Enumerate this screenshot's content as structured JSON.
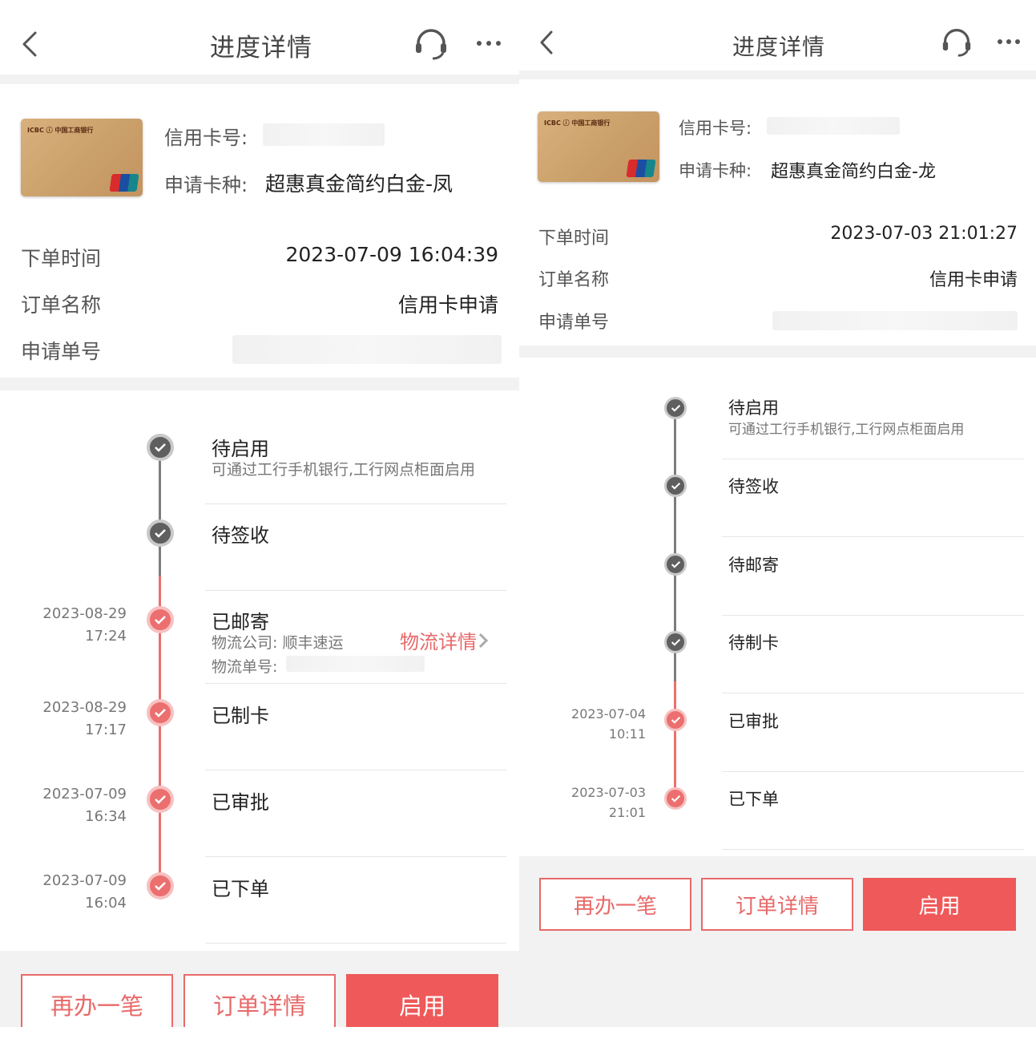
{
  "left": {
    "nav": {
      "title": "进度详情"
    },
    "card": {
      "number_label": "信用卡号:",
      "type_label": "申请卡种:",
      "type_value": "超惠真金简约白金-凤",
      "bank_text": "ICBC ⓘ 中国工商银行"
    },
    "order": [
      {
        "label": "下单时间",
        "value": "2023-07-09 16:04:39"
      },
      {
        "label": "订单名称",
        "value": "信用卡申请"
      },
      {
        "label": "申请单号",
        "value": ""
      }
    ],
    "timeline": [
      {
        "title": "待启用",
        "sub": "可通过工行手机银行,工行网点柜面启用",
        "date": "",
        "time": "",
        "state": "gray"
      },
      {
        "title": "待签收",
        "sub": "",
        "date": "",
        "time": "",
        "state": "gray"
      },
      {
        "title": "已邮寄",
        "sub": "物流公司:  顺丰速运",
        "sub2": "物流单号:",
        "link": "物流详情",
        "date": "2023-08-29",
        "time": "17:24",
        "state": "red"
      },
      {
        "title": "已制卡",
        "sub": "",
        "date": "2023-08-29",
        "time": "17:17",
        "state": "red"
      },
      {
        "title": "已审批",
        "sub": "",
        "date": "2023-07-09",
        "time": "16:34",
        "state": "red"
      },
      {
        "title": "已下单",
        "sub": "",
        "date": "2023-07-09",
        "time": "16:04",
        "state": "red"
      }
    ],
    "buttons": {
      "again": "再办一笔",
      "detail": "订单详情",
      "activate": "启用"
    }
  },
  "right": {
    "nav": {
      "title": "进度详情"
    },
    "card": {
      "number_label": "信用卡号:",
      "type_label": "申请卡种:",
      "type_value": "超惠真金简约白金-龙",
      "bank_text": "ICBC ⓘ 中国工商银行"
    },
    "order": [
      {
        "label": "下单时间",
        "value": "2023-07-03 21:01:27"
      },
      {
        "label": "订单名称",
        "value": "信用卡申请"
      },
      {
        "label": "申请单号",
        "value": ""
      }
    ],
    "timeline": [
      {
        "title": "待启用",
        "sub": "可通过工行手机银行,工行网点柜面启用",
        "date": "",
        "time": "",
        "state": "gray"
      },
      {
        "title": "待签收",
        "sub": "",
        "date": "",
        "time": "",
        "state": "gray"
      },
      {
        "title": "待邮寄",
        "sub": "",
        "date": "",
        "time": "",
        "state": "gray"
      },
      {
        "title": "待制卡",
        "sub": "",
        "date": "",
        "time": "",
        "state": "gray"
      },
      {
        "title": "已审批",
        "sub": "",
        "date": "2023-07-04",
        "time": "10:11",
        "state": "red"
      },
      {
        "title": "已下单",
        "sub": "",
        "date": "2023-07-03",
        "time": "21:01",
        "state": "red"
      }
    ],
    "buttons": {
      "again": "再办一笔",
      "detail": "订单详情",
      "activate": "启用"
    }
  },
  "colors": {
    "accent": "#ef5959",
    "accent_outline": "#e86a6a",
    "timeline_gray": "#5f5f5f",
    "timeline_red": "#ec6f6f"
  }
}
